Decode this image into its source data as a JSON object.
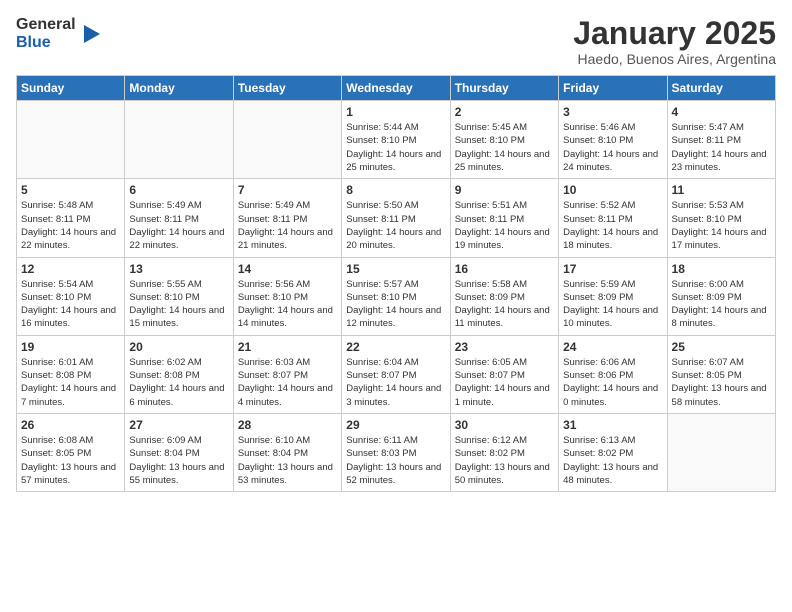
{
  "header": {
    "logo_general": "General",
    "logo_blue": "Blue",
    "main_title": "January 2025",
    "subtitle": "Haedo, Buenos Aires, Argentina"
  },
  "weekdays": [
    "Sunday",
    "Monday",
    "Tuesday",
    "Wednesday",
    "Thursday",
    "Friday",
    "Saturday"
  ],
  "weeks": [
    [
      {
        "day": "",
        "info": ""
      },
      {
        "day": "",
        "info": ""
      },
      {
        "day": "",
        "info": ""
      },
      {
        "day": "1",
        "info": "Sunrise: 5:44 AM\nSunset: 8:10 PM\nDaylight: 14 hours\nand 25 minutes."
      },
      {
        "day": "2",
        "info": "Sunrise: 5:45 AM\nSunset: 8:10 PM\nDaylight: 14 hours\nand 25 minutes."
      },
      {
        "day": "3",
        "info": "Sunrise: 5:46 AM\nSunset: 8:10 PM\nDaylight: 14 hours\nand 24 minutes."
      },
      {
        "day": "4",
        "info": "Sunrise: 5:47 AM\nSunset: 8:11 PM\nDaylight: 14 hours\nand 23 minutes."
      }
    ],
    [
      {
        "day": "5",
        "info": "Sunrise: 5:48 AM\nSunset: 8:11 PM\nDaylight: 14 hours\nand 22 minutes."
      },
      {
        "day": "6",
        "info": "Sunrise: 5:49 AM\nSunset: 8:11 PM\nDaylight: 14 hours\nand 22 minutes."
      },
      {
        "day": "7",
        "info": "Sunrise: 5:49 AM\nSunset: 8:11 PM\nDaylight: 14 hours\nand 21 minutes."
      },
      {
        "day": "8",
        "info": "Sunrise: 5:50 AM\nSunset: 8:11 PM\nDaylight: 14 hours\nand 20 minutes."
      },
      {
        "day": "9",
        "info": "Sunrise: 5:51 AM\nSunset: 8:11 PM\nDaylight: 14 hours\nand 19 minutes."
      },
      {
        "day": "10",
        "info": "Sunrise: 5:52 AM\nSunset: 8:11 PM\nDaylight: 14 hours\nand 18 minutes."
      },
      {
        "day": "11",
        "info": "Sunrise: 5:53 AM\nSunset: 8:10 PM\nDaylight: 14 hours\nand 17 minutes."
      }
    ],
    [
      {
        "day": "12",
        "info": "Sunrise: 5:54 AM\nSunset: 8:10 PM\nDaylight: 14 hours\nand 16 minutes."
      },
      {
        "day": "13",
        "info": "Sunrise: 5:55 AM\nSunset: 8:10 PM\nDaylight: 14 hours\nand 15 minutes."
      },
      {
        "day": "14",
        "info": "Sunrise: 5:56 AM\nSunset: 8:10 PM\nDaylight: 14 hours\nand 14 minutes."
      },
      {
        "day": "15",
        "info": "Sunrise: 5:57 AM\nSunset: 8:10 PM\nDaylight: 14 hours\nand 12 minutes."
      },
      {
        "day": "16",
        "info": "Sunrise: 5:58 AM\nSunset: 8:09 PM\nDaylight: 14 hours\nand 11 minutes."
      },
      {
        "day": "17",
        "info": "Sunrise: 5:59 AM\nSunset: 8:09 PM\nDaylight: 14 hours\nand 10 minutes."
      },
      {
        "day": "18",
        "info": "Sunrise: 6:00 AM\nSunset: 8:09 PM\nDaylight: 14 hours\nand 8 minutes."
      }
    ],
    [
      {
        "day": "19",
        "info": "Sunrise: 6:01 AM\nSunset: 8:08 PM\nDaylight: 14 hours\nand 7 minutes."
      },
      {
        "day": "20",
        "info": "Sunrise: 6:02 AM\nSunset: 8:08 PM\nDaylight: 14 hours\nand 6 minutes."
      },
      {
        "day": "21",
        "info": "Sunrise: 6:03 AM\nSunset: 8:07 PM\nDaylight: 14 hours\nand 4 minutes."
      },
      {
        "day": "22",
        "info": "Sunrise: 6:04 AM\nSunset: 8:07 PM\nDaylight: 14 hours\nand 3 minutes."
      },
      {
        "day": "23",
        "info": "Sunrise: 6:05 AM\nSunset: 8:07 PM\nDaylight: 14 hours\nand 1 minute."
      },
      {
        "day": "24",
        "info": "Sunrise: 6:06 AM\nSunset: 8:06 PM\nDaylight: 14 hours\nand 0 minutes."
      },
      {
        "day": "25",
        "info": "Sunrise: 6:07 AM\nSunset: 8:05 PM\nDaylight: 13 hours\nand 58 minutes."
      }
    ],
    [
      {
        "day": "26",
        "info": "Sunrise: 6:08 AM\nSunset: 8:05 PM\nDaylight: 13 hours\nand 57 minutes."
      },
      {
        "day": "27",
        "info": "Sunrise: 6:09 AM\nSunset: 8:04 PM\nDaylight: 13 hours\nand 55 minutes."
      },
      {
        "day": "28",
        "info": "Sunrise: 6:10 AM\nSunset: 8:04 PM\nDaylight: 13 hours\nand 53 minutes."
      },
      {
        "day": "29",
        "info": "Sunrise: 6:11 AM\nSunset: 8:03 PM\nDaylight: 13 hours\nand 52 minutes."
      },
      {
        "day": "30",
        "info": "Sunrise: 6:12 AM\nSunset: 8:02 PM\nDaylight: 13 hours\nand 50 minutes."
      },
      {
        "day": "31",
        "info": "Sunrise: 6:13 AM\nSunset: 8:02 PM\nDaylight: 13 hours\nand 48 minutes."
      },
      {
        "day": "",
        "info": ""
      }
    ]
  ]
}
